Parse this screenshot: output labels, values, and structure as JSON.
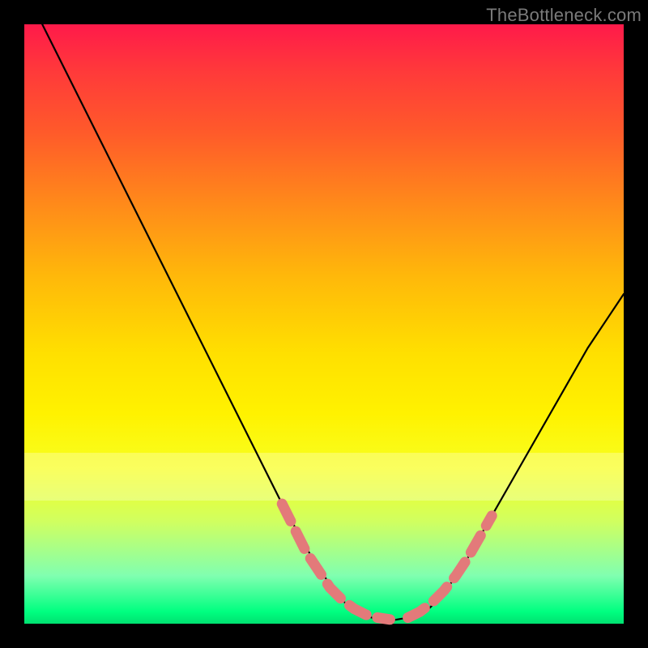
{
  "watermark": "TheBottleneck.com",
  "chart_data": {
    "type": "line",
    "title": "",
    "xlabel": "",
    "ylabel": "",
    "xlim": [
      0,
      100
    ],
    "ylim": [
      0,
      100
    ],
    "series": [
      {
        "name": "bottleneck-curve",
        "color": "#000000",
        "x": [
          3,
          8,
          13,
          18,
          23,
          28,
          33,
          38,
          43,
          48,
          52,
          55,
          58,
          61,
          64,
          67,
          70,
          74,
          78,
          82,
          86,
          90,
          94,
          98,
          100
        ],
        "y": [
          100,
          90,
          80,
          70,
          60,
          50,
          40,
          30,
          20,
          11,
          5,
          2,
          1,
          0.5,
          1,
          2,
          5,
          11,
          18,
          25,
          32,
          39,
          46,
          52,
          55
        ]
      },
      {
        "name": "highlight-band-left",
        "color": "#e37a7a",
        "x": [
          43,
          45,
          47,
          49,
          51,
          53,
          55,
          57,
          59,
          61
        ],
        "y": [
          20,
          16,
          12,
          9,
          6,
          4,
          2.5,
          1.5,
          1,
          0.7
        ]
      },
      {
        "name": "highlight-band-right",
        "color": "#e37a7a",
        "x": [
          64,
          66,
          68,
          70,
          72,
          74,
          76,
          78
        ],
        "y": [
          1,
          2,
          3.5,
          5.5,
          8,
          11,
          14.5,
          18
        ]
      }
    ],
    "gradient_stops": [
      {
        "pos": 0,
        "color": "#ff1a4a"
      },
      {
        "pos": 55,
        "color": "#ffe000"
      },
      {
        "pos": 100,
        "color": "#00e070"
      }
    ]
  }
}
